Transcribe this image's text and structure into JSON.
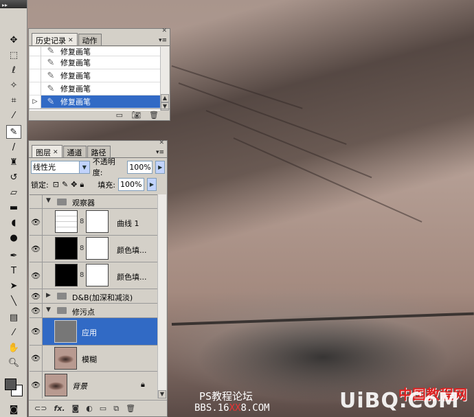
{
  "history_panel": {
    "tabs": [
      "历史记录",
      "动作"
    ],
    "items": [
      "修复画笔",
      "修复画笔",
      "修复画笔",
      "修复画笔",
      "修复画笔"
    ],
    "selected_index": 4
  },
  "layers_panel": {
    "tabs": [
      "图层",
      "通道",
      "路径"
    ],
    "blend_mode": "线性光",
    "opacity_label": "不透明度:",
    "opacity_value": "100%",
    "lock_label": "锁定:",
    "fill_label": "填充:",
    "fill_value": "100%",
    "layers": [
      {
        "name": "观察器",
        "kind": "group",
        "visible": false
      },
      {
        "name": "曲线 1",
        "kind": "adjustment",
        "visible": true
      },
      {
        "name": "颜色填...",
        "kind": "fill",
        "visible": true
      },
      {
        "name": "颜色填...",
        "kind": "fill",
        "visible": true
      },
      {
        "name": "D&B(加深和减淡)",
        "kind": "group",
        "visible": true
      },
      {
        "name": "修污点",
        "kind": "group",
        "visible": true
      },
      {
        "name": "应用",
        "kind": "layer",
        "visible": true,
        "selected": true
      },
      {
        "name": "模糊",
        "kind": "layer",
        "visible": true
      },
      {
        "name": "背景",
        "kind": "background",
        "visible": true
      }
    ],
    "footer_fx": "fx."
  },
  "watermark": {
    "line1": "PS教程论坛",
    "line2_a": "BBS.16",
    "line2_b": "XX",
    "line2_c": "8.COM",
    "brand": "UiBQ.CoM",
    "brand_cn": "中国教程网"
  },
  "colors": {
    "selection": "#316ac5",
    "panel_bg": "#d4d0c8"
  }
}
